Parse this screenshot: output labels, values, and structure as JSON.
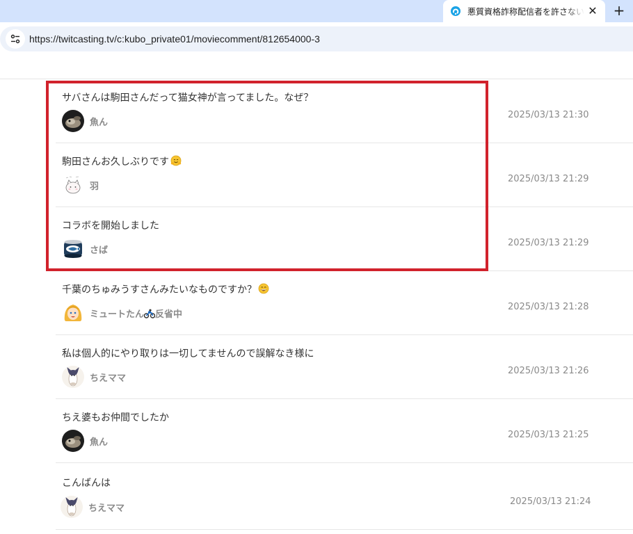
{
  "browser": {
    "tab_title": "悪質資格詐称配信者を許さない！",
    "tab_close": "✕",
    "new_tab": "+",
    "url": "https://twitcasting.tv/c:kubo_private01/moviecomment/812654000-3"
  },
  "colors": {
    "highlight": "#d1222c",
    "tabstrip": "#d3e3fd",
    "omnibox": "#edf2fa",
    "muted_text": "#8a8a8a"
  },
  "comments": [
    {
      "text": "サバさんは駒田さんだって猫女神が言ってました。なぜ？",
      "user": "魚ん",
      "date": "2025/03/13 21:30",
      "avatar": "fish-avatar-icon"
    },
    {
      "text": "駒田さんお久しぶりです",
      "emoji": "hugging-face-emoji",
      "user": "羽",
      "date": "2025/03/13 21:29",
      "avatar": "cat-sketch-avatar-icon"
    },
    {
      "text": "コラボを開始しました",
      "user": "さば",
      "date": "2025/03/13 21:29",
      "avatar": "mackerel-can-avatar-icon"
    },
    {
      "text": "千葉のちゅみうすさんみたいなものですか？",
      "emoji": "grinning-face-emoji",
      "user": "ミュートたん",
      "user_suffix_icon": "motorcycle-icon",
      "user_suffix": "反省中",
      "date": "2025/03/13 21:28",
      "avatar": "blonde-girl-avatar-icon"
    },
    {
      "text": "私は個人的にやり取りは一切してませんので誤解なき様に",
      "user": "ちえママ",
      "date": "2025/03/13 21:26",
      "avatar": "cat-illustration-avatar-icon"
    },
    {
      "text": "ちえ婆もお仲間でしたか",
      "user": "魚ん",
      "date": "2025/03/13 21:25",
      "avatar": "fish-avatar-icon"
    },
    {
      "text": "こんばんは",
      "user": "ちえママ",
      "date": "2025/03/13 21:24",
      "avatar": "cat-illustration-avatar-icon"
    }
  ]
}
